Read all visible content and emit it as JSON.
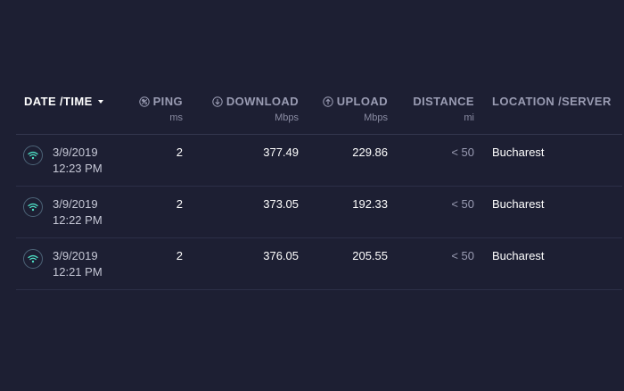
{
  "header": {
    "date_time": "DATE /TIME",
    "ping": "PING",
    "ping_unit": "ms",
    "download": "DOWNLOAD",
    "download_unit": "Mbps",
    "upload": "UPLOAD",
    "upload_unit": "Mbps",
    "distance": "DISTANCE",
    "distance_unit": "mi",
    "location": "LOCATION /SERVER"
  },
  "rows": [
    {
      "date": "3/9/2019",
      "time": "12:23 PM",
      "ping": "2",
      "download": "377.49",
      "upload": "229.86",
      "distance": "< 50",
      "location": "Bucharest"
    },
    {
      "date": "3/9/2019",
      "time": "12:22 PM",
      "ping": "2",
      "download": "373.05",
      "upload": "192.33",
      "distance": "< 50",
      "location": "Bucharest"
    },
    {
      "date": "3/9/2019",
      "time": "12:21 PM",
      "ping": "2",
      "download": "376.05",
      "upload": "205.55",
      "distance": "< 50",
      "location": "Bucharest"
    }
  ],
  "colors": {
    "background": "#1d1f33",
    "accent_wifi": "#4fe3c8",
    "header_text": "#9a9cb3"
  },
  "icons": {
    "ping": "ping-icon",
    "download": "download-arrow-icon",
    "upload": "upload-arrow-icon",
    "connection": "wifi-icon"
  }
}
